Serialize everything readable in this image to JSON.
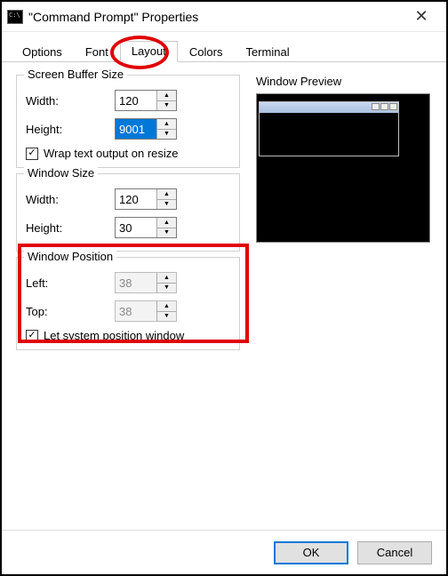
{
  "window": {
    "title": "\"Command Prompt\" Properties"
  },
  "tabs": {
    "options": "Options",
    "font": "Font",
    "layout": "Layout",
    "colors": "Colors",
    "terminal": "Terminal"
  },
  "groups": {
    "screenBuffer": {
      "title": "Screen Buffer Size",
      "widthLabel": "Width:",
      "widthValue": "120",
      "heightLabel": "Height:",
      "heightValue": "9001",
      "wrapLabel": "Wrap text output on resize",
      "wrapChecked": true
    },
    "windowSize": {
      "title": "Window Size",
      "widthLabel": "Width:",
      "widthValue": "120",
      "heightLabel": "Height:",
      "heightValue": "30"
    },
    "windowPosition": {
      "title": "Window Position",
      "leftLabel": "Left:",
      "leftValue": "38",
      "topLabel": "Top:",
      "topValue": "38",
      "autoLabel": "Let system position window",
      "autoChecked": true
    }
  },
  "preview": {
    "title": "Window Preview"
  },
  "buttons": {
    "ok": "OK",
    "cancel": "Cancel"
  }
}
